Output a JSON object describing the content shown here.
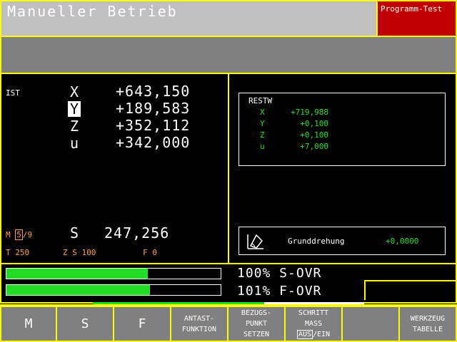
{
  "header": {
    "title": "Manueller Betrieb",
    "mode": "Programm-Test"
  },
  "position": {
    "label": "IST",
    "axes": [
      {
        "axis": "X",
        "value": "+643,150",
        "selected": false
      },
      {
        "axis": "Y",
        "value": "+189,583",
        "selected": true
      },
      {
        "axis": "Z",
        "value": "+352,112",
        "selected": false
      },
      {
        "axis": "u",
        "value": "+342,000",
        "selected": false
      }
    ]
  },
  "status": {
    "m_prefix": "M",
    "m_boxed": "5",
    "m_suffix": "/9",
    "s_letter": "S",
    "s_value": "247,256",
    "t_line": "T 250",
    "zs_line": "Z S 100",
    "f_line": "F 0"
  },
  "restweg": {
    "title": "RESTW",
    "rows": [
      {
        "axis": "X",
        "value": "+719,988"
      },
      {
        "axis": "Y",
        "value": "+0,100"
      },
      {
        "axis": "Z",
        "value": "+0,100"
      },
      {
        "axis": "u",
        "value": "+7,000"
      }
    ]
  },
  "grunddrehung": {
    "label": "Grunddrehung",
    "value": "+0,0000",
    "icon": "basic-rotation-icon"
  },
  "overrides": {
    "s_ovr": {
      "text": "100% S-OVR",
      "fill_fraction": 0.66
    },
    "f_ovr": {
      "text": "101% F-OVR",
      "fill_fraction": 0.67
    }
  },
  "softkeys": {
    "m": "M",
    "s": "S",
    "f": "F",
    "antast_1": "ANTAST-",
    "antast_2": "FUNKTION",
    "bezugs_1": "BEZUGS-",
    "bezugs_2": "PUNKT",
    "bezugs_3": "SETZEN",
    "schritt_1": "SCHRITT",
    "schritt_2": "MASS",
    "schritt_aus": "AUS",
    "schritt_ein": "/EIN",
    "werkzeug_1": "WERKZEUG",
    "werkzeug_2": "TABELLE"
  },
  "colors": {
    "accent_frame": "#ffff00",
    "active_green": "#22dd22",
    "status_orange": "#ffa040",
    "mode_red": "#c00000"
  }
}
